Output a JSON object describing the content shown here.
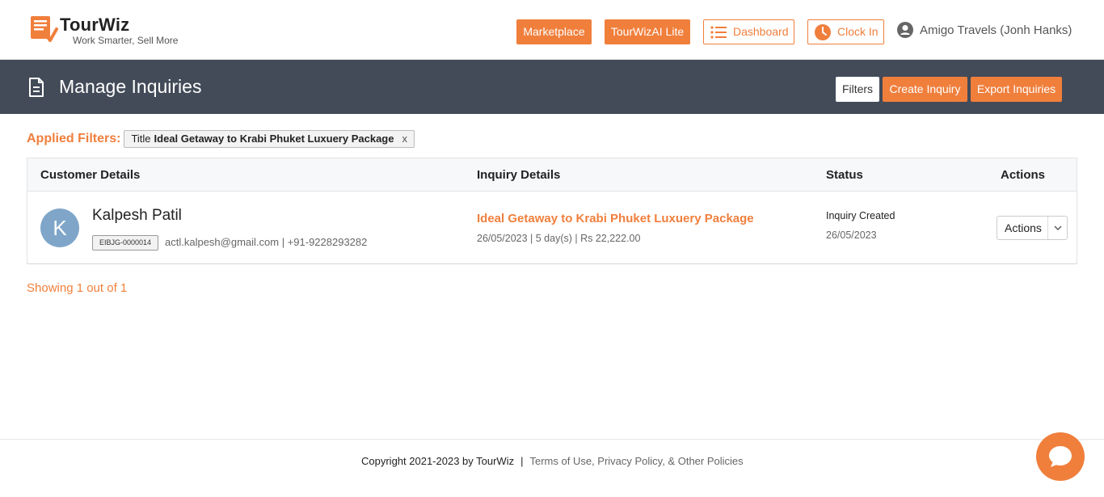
{
  "brand": {
    "name": "TourWiz",
    "tagline": "Work Smarter, Sell More"
  },
  "header": {
    "marketplace_label": "Marketplace",
    "ai_label": "TourWizAI Lite",
    "dashboard_label": "Dashboard",
    "clockin_label": "Clock In",
    "user_label": "Amigo Travels (Jonh Hanks)"
  },
  "page": {
    "title": "Manage Inquiries",
    "filters_label": "Filters",
    "create_label": "Create Inquiry",
    "export_label": "Export Inquiries"
  },
  "applied_filters": {
    "label": "Applied Filters:",
    "chips": [
      {
        "key": "Title",
        "value": "Ideal Getaway to Krabi Phuket Luxuery Package",
        "close": "x"
      }
    ]
  },
  "table": {
    "headers": [
      "Customer Details",
      "Inquiry Details",
      "Status",
      "Actions"
    ],
    "rows": [
      {
        "avatar_letter": "K",
        "customer_name": "Kalpesh Patil",
        "customer_id": "EIBJG-0000014",
        "contact": "actl.kalpesh@gmail.com | +91-9228293282",
        "inquiry_title": "Ideal Getaway to Krabi Phuket Luxuery Package",
        "inquiry_meta": "26/05/2023 | 5 day(s) | Rs 22,222.00",
        "status": "Inquiry Created",
        "status_date": "26/05/2023",
        "actions_label": "Actions"
      }
    ]
  },
  "pagination": {
    "showing": "Showing 1 out of 1"
  },
  "footer": {
    "copyright": "Copyright 2021-2023 by TourWiz",
    "separator": "|",
    "links": "Terms of Use, Privacy Policy, & Other Policies"
  },
  "colors": {
    "accent": "#f07f3c",
    "header_dark": "#434b59",
    "avatar": "#7fa6c9"
  },
  "icons": [
    "tourwiz-logo",
    "list-icon",
    "clock-icon",
    "user-icon",
    "document-icon",
    "chevron-down-icon",
    "chat-icon"
  ]
}
